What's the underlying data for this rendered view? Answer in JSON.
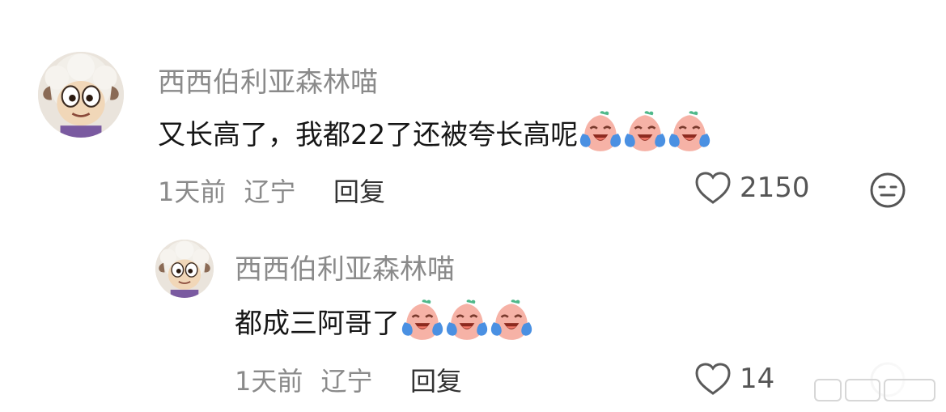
{
  "comments": [
    {
      "username": "西西伯利亚森林喵",
      "text": "又长高了，我都22了还被夸长高呢",
      "emoji": "crying-laughing-peach-emoji",
      "emoji_count": 3,
      "time": "1天前",
      "location": "辽宁",
      "reply_label": "回复",
      "likes": "2150"
    },
    {
      "username": "西西伯利亚森林喵",
      "text": "都成三阿哥了",
      "emoji": "crying-laughing-peach-emoji",
      "emoji_count": 3,
      "time": "1天前",
      "location": "辽宁",
      "reply_label": "回复",
      "likes": "14"
    }
  ],
  "icons": {
    "like": "heart-outline-icon",
    "more": "expressionless-face-icon"
  },
  "colors": {
    "username": "#8a8a8a",
    "text": "#161616",
    "meta": "#8a8a8a",
    "emoji_face": "#f4a7a0",
    "emoji_leaf": "#4fb88a",
    "emoji_tear": "#4a90e2"
  }
}
